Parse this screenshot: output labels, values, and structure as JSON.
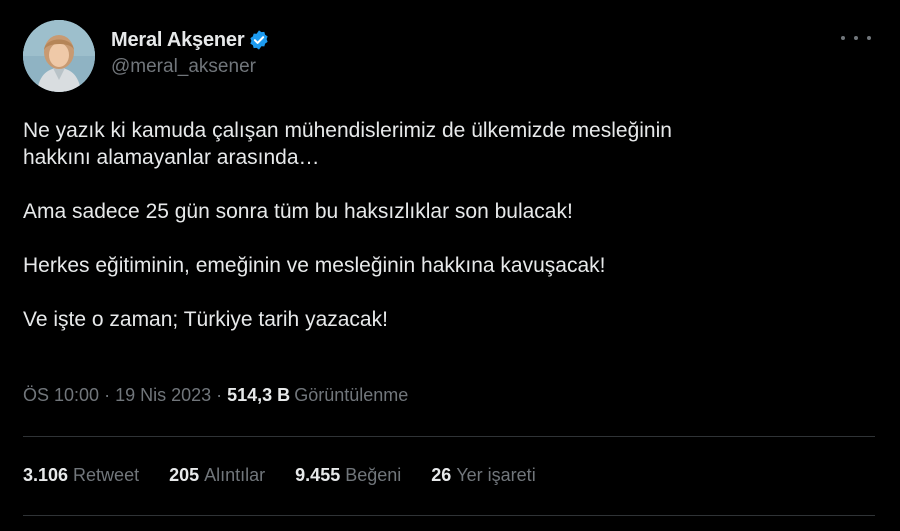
{
  "author": {
    "display_name": "Meral Akşener",
    "handle": "@meral_aksener",
    "verified": true
  },
  "tweet": {
    "paragraphs": [
      "Ne yazık ki kamuda çalışan mühendislerimiz de ülkemizde mesleğinin\nhakkını alamayanlar arasında…",
      "Ama sadece 25 gün sonra tüm bu haksızlıklar son bulacak!",
      "Herkes eğitiminin, emeğinin ve mesleğinin hakkına kavuşacak!",
      "Ve işte o zaman; Türkiye tarih yazacak!"
    ]
  },
  "meta": {
    "time": "ÖS 10:00",
    "separator": "·",
    "date": "19 Nis 2023",
    "views_count": "514,3 B",
    "views_label": "Görüntülenme"
  },
  "stats": [
    {
      "count": "3.106",
      "label": "Retweet"
    },
    {
      "count": "205",
      "label": "Alıntılar"
    },
    {
      "count": "9.455",
      "label": "Beğeni"
    },
    {
      "count": "26",
      "label": "Yer işareti"
    }
  ],
  "colors": {
    "background": "#000000",
    "text": "#e7e9ea",
    "secondary": "#71767b",
    "verified": "#1d9bf0",
    "divider": "#2f3336"
  },
  "icons": {
    "verified": "verified-badge-icon",
    "more": "more-horizontal-icon"
  }
}
